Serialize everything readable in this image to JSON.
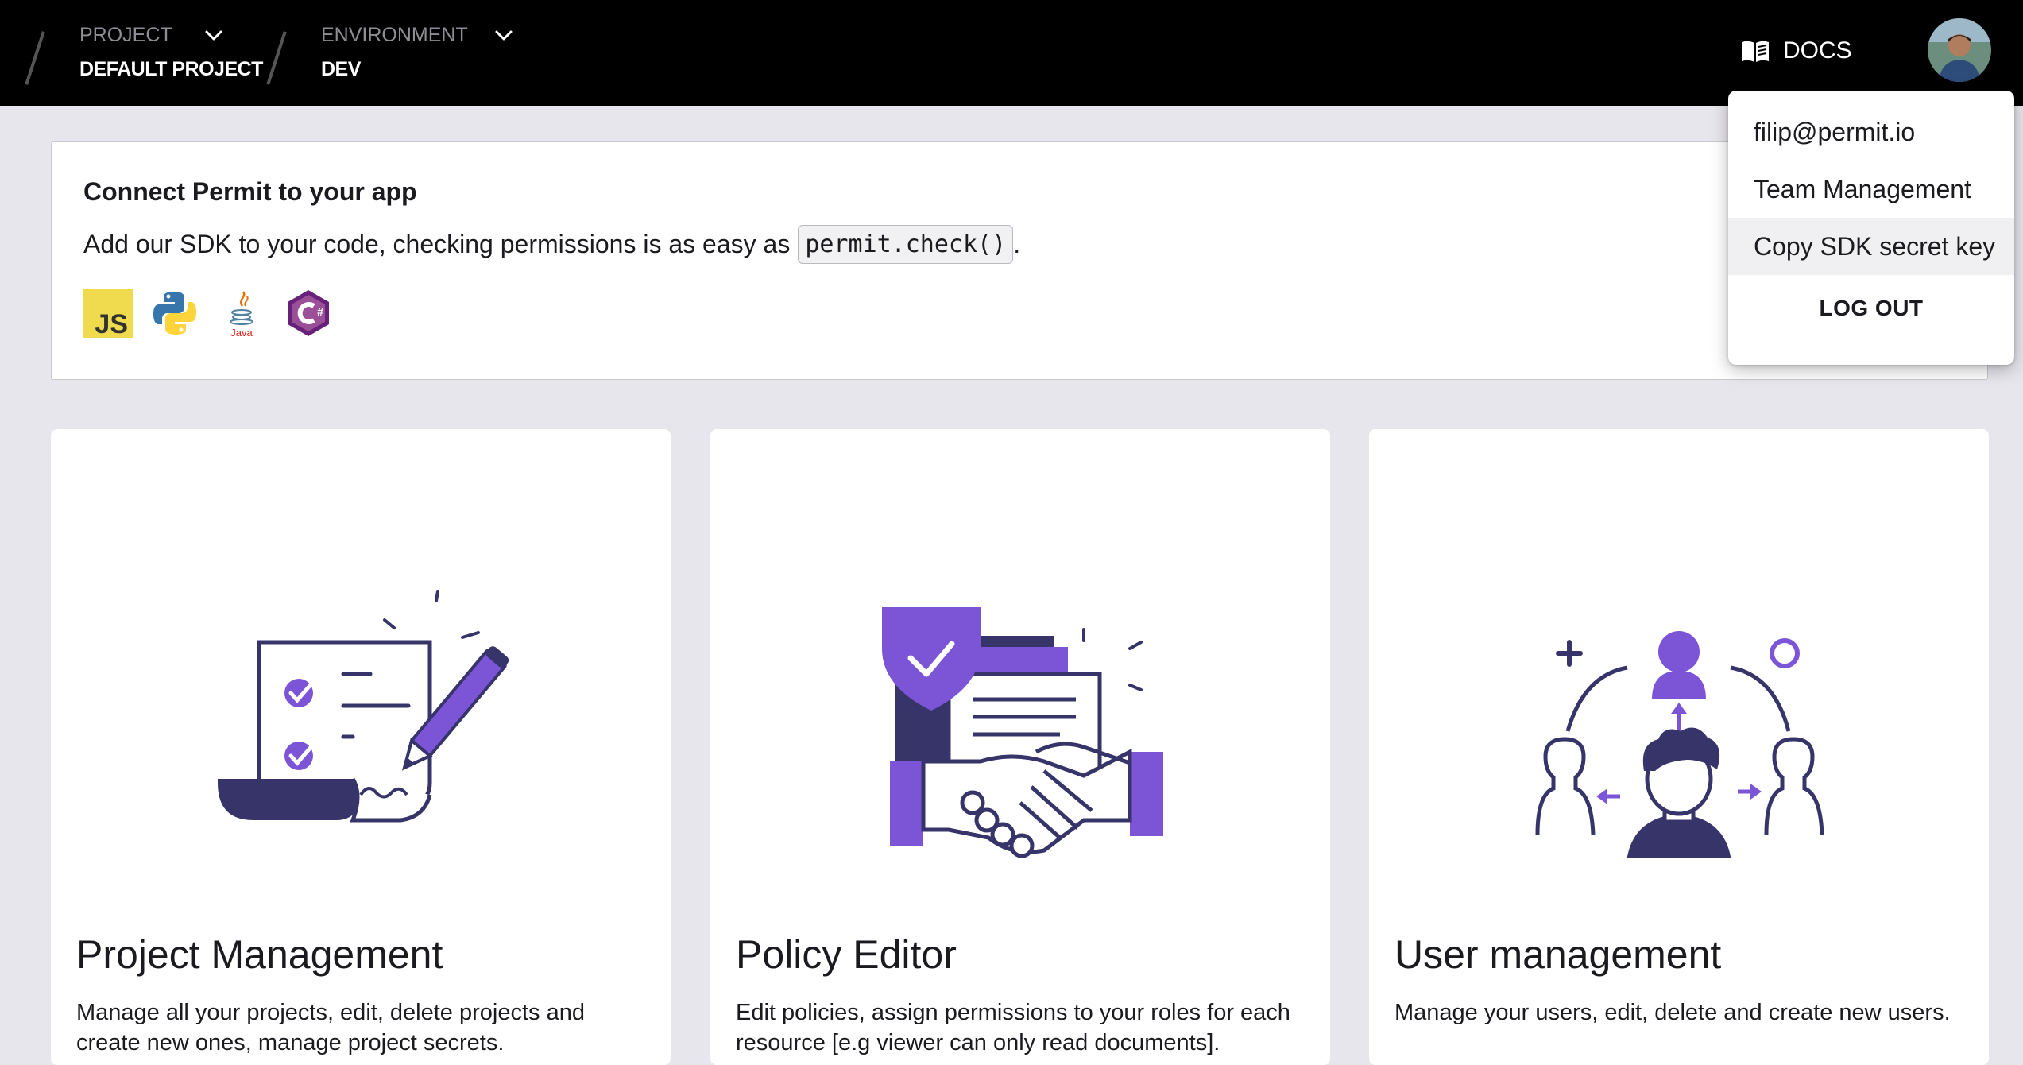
{
  "header": {
    "project_label": "PROJECT",
    "project_value": "DEFAULT PROJECT",
    "environment_label": "ENVIRONMENT",
    "environment_value": "DEV",
    "docs_label": "DOCS",
    "docs_icon": "book-icon"
  },
  "connect": {
    "title": "Connect Permit to your app",
    "description": "Add our SDK to your code, checking permissions is as easy as",
    "code": "permit.check()",
    "trailing": ".",
    "languages": [
      "js-icon",
      "python-icon",
      "java-icon",
      "csharp-icon"
    ],
    "java_text": "Java",
    "js_text": "JS"
  },
  "cards": [
    {
      "title": "Project Management",
      "description": "Manage all your projects, edit, delete projects and create new ones, manage project secrets."
    },
    {
      "title": "Policy Editor",
      "description": "Edit policies, assign permissions to your roles for each resource [e.g viewer can only read documents]."
    },
    {
      "title": "User management",
      "description": "Manage your users, edit, delete and create new users."
    }
  ],
  "menu": {
    "email": "filip@permit.io",
    "team": "Team Management",
    "copy_key": "Copy SDK secret key",
    "logout": "LOG OUT"
  },
  "colors": {
    "accent": "#7b55d6",
    "navy": "#37346a",
    "topbar": "#000000",
    "background": "#e7e6ec"
  }
}
